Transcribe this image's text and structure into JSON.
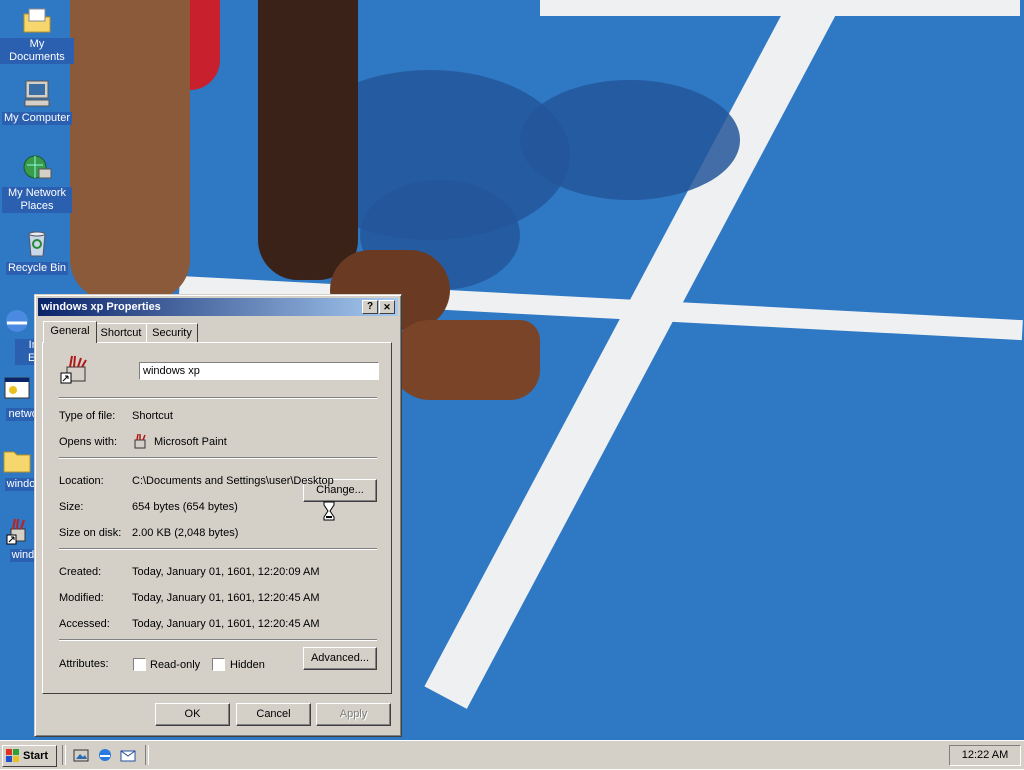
{
  "desktop": {
    "icons": [
      {
        "label": "My Documents",
        "icon": "folder-documents-icon"
      },
      {
        "label": "My Computer",
        "icon": "computer-icon"
      },
      {
        "label": "My Network Places",
        "icon": "network-places-icon"
      },
      {
        "label": "Recycle Bin",
        "icon": "recycle-bin-icon"
      },
      {
        "label": "Inte Exp",
        "icon": "internet-explorer-icon"
      },
      {
        "label": "networ",
        "icon": "network-icon"
      },
      {
        "label": "window",
        "icon": "folder-icon"
      },
      {
        "label": "windo",
        "icon": "paint-shortcut-icon"
      }
    ]
  },
  "dialog": {
    "title": "windows xp Properties",
    "help_button": "?",
    "close_button": "✕",
    "tabs": [
      "General",
      "Shortcut",
      "Security"
    ],
    "active_tab": "General",
    "name_value": "windows xp",
    "type_label": "Type of file:",
    "type_value": "Shortcut",
    "opens_label": "Opens with:",
    "opens_value": "Microsoft Paint",
    "change_button": "Change...",
    "location_label": "Location:",
    "location_value": "C:\\Documents and Settings\\user\\Desktop",
    "size_label": "Size:",
    "size_value": "654 bytes (654 bytes)",
    "size_disk_label": "Size on disk:",
    "size_disk_value": "2.00 KB (2,048 bytes)",
    "created_label": "Created:",
    "created_value": "Today, January 01, 1601, 12:20:09 AM",
    "modified_label": "Modified:",
    "modified_value": "Today, January 01, 1601, 12:20:45 AM",
    "accessed_label": "Accessed:",
    "accessed_value": "Today, January 01, 1601, 12:20:45 AM",
    "attributes_label": "Attributes:",
    "readonly_label": "Read-only",
    "hidden_label": "Hidden",
    "advanced_button": "Advanced...",
    "ok_button": "OK",
    "cancel_button": "Cancel",
    "apply_button": "Apply"
  },
  "taskbar": {
    "start_label": "Start",
    "quick_launch": [
      "show-desktop-icon",
      "internet-explorer-icon",
      "outlook-express-icon"
    ],
    "clock": "12:22 AM"
  },
  "colors": {
    "titlebar_start": "#0a246a",
    "titlebar_end": "#a6caf0",
    "face": "#d4d0c8",
    "wallpaper": "#2f78c4"
  }
}
